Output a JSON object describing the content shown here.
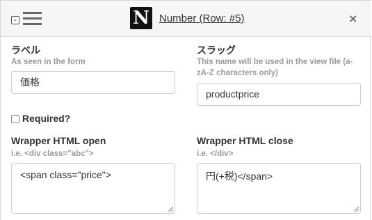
{
  "header": {
    "collapse_label": "-",
    "logo_letter": "N",
    "title": "Number (Row: #5)",
    "close_label": "×"
  },
  "label_field": {
    "label": "ラベル",
    "help": "As seen in the form",
    "value": "価格"
  },
  "slug_field": {
    "label": "スラッグ",
    "help_line1": "This name will be used in the view file (a-",
    "help_line2": "zA-Z characters only)",
    "value": "productprice"
  },
  "required": {
    "label": "Required?",
    "checked": false
  },
  "wrapper_open": {
    "label": "Wrapper HTML open",
    "help": "i.e. <div class=\"abc\">",
    "value": "<span class=\"price\">"
  },
  "wrapper_close": {
    "label": "Wrapper HTML close",
    "help": "i.e. </div>",
    "value": "円(+税)</span>"
  }
}
